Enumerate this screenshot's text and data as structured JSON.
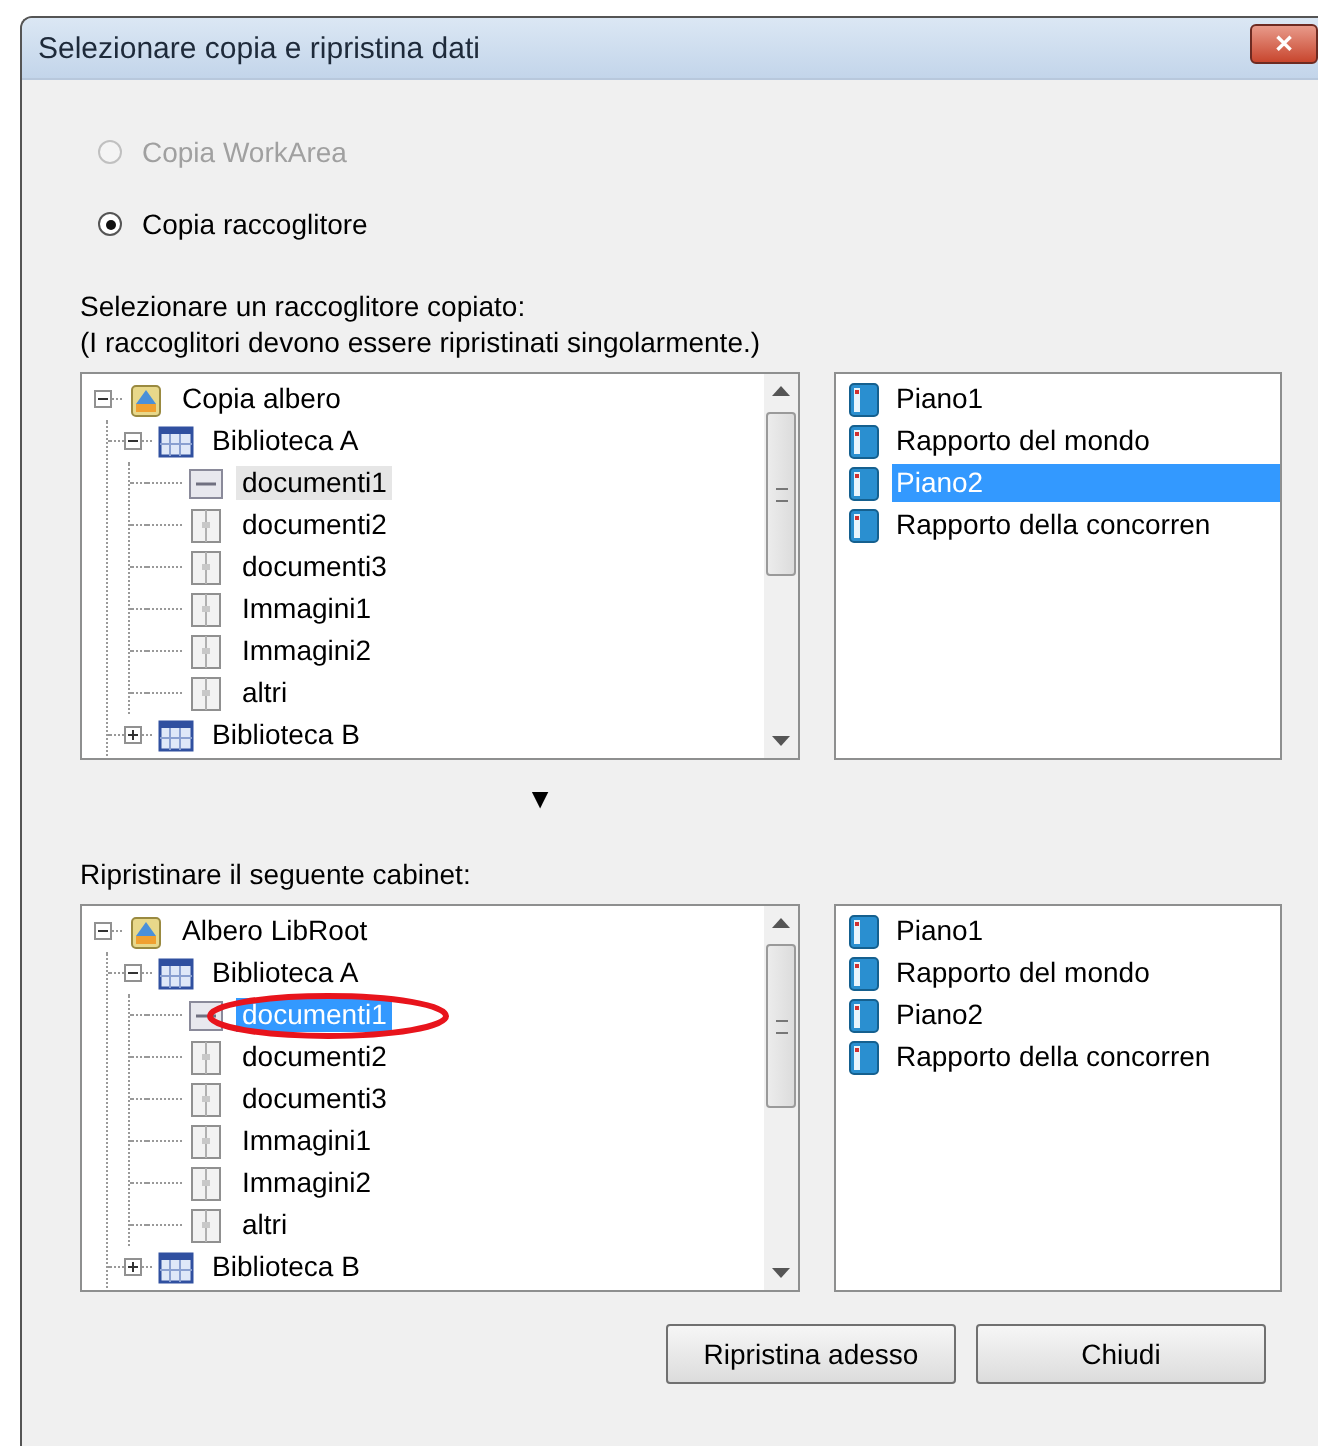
{
  "window": {
    "title": "Selezionare copia e ripristina dati",
    "close": "✕"
  },
  "options": [
    {
      "label": "Copia WorkArea",
      "selected": false,
      "disabled": true
    },
    {
      "label": "Copia raccoglitore",
      "selected": true,
      "disabled": false
    }
  ],
  "source": {
    "instructions": [
      "Selezionare un raccoglitore copiato:",
      "(I raccoglitori devono essere ripristinati singolarmente.)"
    ],
    "tree": {
      "focused": false,
      "nodes": [
        {
          "label": "Copia albero",
          "kind": "root",
          "expanded": true,
          "selected": false,
          "children": [
            {
              "label": "Biblioteca A",
              "kind": "library",
              "expanded": true,
              "selected": false,
              "children": [
                {
                  "label": "documenti1",
                  "kind": "cabinet",
                  "selected": true
                },
                {
                  "label": "documenti2",
                  "kind": "binder",
                  "selected": false
                },
                {
                  "label": "documenti3",
                  "kind": "binder",
                  "selected": false
                },
                {
                  "label": "Immagini1",
                  "kind": "binder",
                  "selected": false
                },
                {
                  "label": "Immagini2",
                  "kind": "binder",
                  "selected": false
                },
                {
                  "label": "altri",
                  "kind": "binder",
                  "selected": false
                }
              ]
            },
            {
              "label": "Biblioteca B",
              "kind": "library",
              "expanded": false,
              "selected": false
            }
          ]
        }
      ]
    },
    "binders": [
      {
        "label": "Piano1",
        "selected": false
      },
      {
        "label": "Rapporto del mondo",
        "selected": false
      },
      {
        "label": "Piano2",
        "selected": true
      },
      {
        "label": "Rapporto della concorren",
        "selected": false
      }
    ]
  },
  "arrow": "▼",
  "target": {
    "label": "Ripristinare il seguente cabinet:",
    "tree": {
      "focused": true,
      "nodes": [
        {
          "label": "Albero LibRoot",
          "kind": "root",
          "expanded": true,
          "selected": false,
          "circled": false,
          "children": [
            {
              "label": "Biblioteca A",
              "kind": "library",
              "expanded": true,
              "selected": false,
              "circled": false,
              "children": [
                {
                  "label": "documenti1",
                  "kind": "cabinet",
                  "selected": true,
                  "circled": true
                },
                {
                  "label": "documenti2",
                  "kind": "binder",
                  "selected": false,
                  "circled": false
                },
                {
                  "label": "documenti3",
                  "kind": "binder",
                  "selected": false,
                  "circled": false
                },
                {
                  "label": "Immagini1",
                  "kind": "binder",
                  "selected": false,
                  "circled": false
                },
                {
                  "label": "Immagini2",
                  "kind": "binder",
                  "selected": false,
                  "circled": false
                },
                {
                  "label": "altri",
                  "kind": "binder",
                  "selected": false,
                  "circled": false
                }
              ]
            },
            {
              "label": "Biblioteca B",
              "kind": "library",
              "expanded": false,
              "selected": false,
              "circled": false
            }
          ]
        }
      ]
    },
    "binders": [
      {
        "label": "Piano1",
        "selected": false
      },
      {
        "label": "Rapporto del mondo",
        "selected": false
      },
      {
        "label": "Piano2",
        "selected": false
      },
      {
        "label": "Rapporto della concorren",
        "selected": false
      }
    ]
  },
  "buttons": [
    "Ripristina adesso",
    "Chiudi"
  ]
}
